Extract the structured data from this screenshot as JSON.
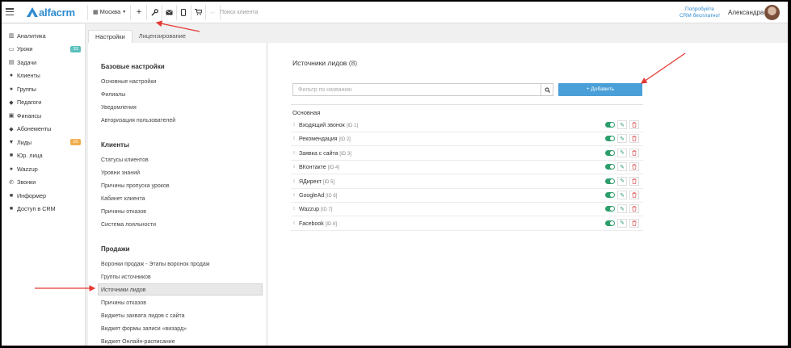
{
  "app": {
    "logo_text": "alfacrm",
    "brand_color": "#2e8bcf",
    "city": "Москва",
    "search_placeholder": "Поиск клиента",
    "try_free": "Попробуйте CRM бесплатно!",
    "user_name": "Александра"
  },
  "toolbar_icons": [
    "building-icon",
    "plus-icon",
    "wrench-icon",
    "mail-icon",
    "phone-icon",
    "cart-icon",
    "minus-icon"
  ],
  "sidebar": {
    "items": [
      {
        "label": "Аналитика",
        "icon": "chart-icon",
        "glyph": "▥"
      },
      {
        "label": "Уроки",
        "icon": "calendar-icon",
        "glyph": "▭",
        "badge": "33",
        "badge_color": "#5bc0be"
      },
      {
        "label": "Задачи",
        "icon": "clipboard-icon",
        "glyph": "▤"
      },
      {
        "label": "Клиенты",
        "icon": "user-icon",
        "glyph": "●"
      },
      {
        "label": "Группы",
        "icon": "users-icon",
        "glyph": "●"
      },
      {
        "label": "Педагоги",
        "icon": "graduation-cap-icon",
        "glyph": "◆"
      },
      {
        "label": "Финансы",
        "icon": "money-icon",
        "glyph": "▣"
      },
      {
        "label": "Абонементы",
        "icon": "tag-icon",
        "glyph": "◆"
      },
      {
        "label": "Лиды",
        "icon": "funnel-icon",
        "glyph": "▼",
        "badge": "22",
        "badge_color": "#f0ad4e"
      },
      {
        "label": "Юр. лица",
        "icon": "briefcase-icon",
        "glyph": "■"
      },
      {
        "label": "Wazzup",
        "icon": "whatsapp-icon",
        "glyph": "●"
      },
      {
        "label": "Звонки",
        "icon": "phone-icon",
        "glyph": "✆"
      },
      {
        "label": "Информер",
        "icon": "bookmark-icon",
        "glyph": "■"
      },
      {
        "label": "Доступ в CRM",
        "icon": "lock-icon",
        "glyph": "■"
      }
    ]
  },
  "tabs": [
    {
      "label": "Настройки",
      "active": true
    },
    {
      "label": "Лицензирование",
      "active": false
    }
  ],
  "settings": {
    "sections": [
      {
        "title": "Базовые настройки",
        "links": [
          "Основные настройки",
          "Филиалы",
          "Уведомления",
          "Авторизация пользователей"
        ]
      },
      {
        "title": "Клиенты",
        "links": [
          "Статусы клиентов",
          "Уровни знаний",
          "Причины пропуска уроков",
          "Кабинет клиента",
          "Причины отказов",
          "Система лояльности"
        ]
      },
      {
        "title": "Продажи",
        "links": [
          "Воронки продаж - Этапы воронок продаж",
          "Группы источников",
          "Источники лидов",
          "Причины отказов",
          "Виджеты захвата лидов с сайта",
          "Виджет формы записи «визард»",
          "Виджет Онлайн-расписание"
        ]
      }
    ],
    "active_link": "Источники лидов"
  },
  "main": {
    "title": "Источники лидов",
    "count": "(8)",
    "filter_placeholder": "Фильтр по названию",
    "add_button": "+ Добавить",
    "group_label": "Основная",
    "toggle_color": "#2e9e6b",
    "rows": [
      {
        "name": "Входящий звонок",
        "id": "[ID 1]"
      },
      {
        "name": "Рекомендация",
        "id": "[ID 2]"
      },
      {
        "name": "Заявка с сайта",
        "id": "[ID 3]"
      },
      {
        "name": "ВКонтакте",
        "id": "[ID 4]"
      },
      {
        "name": "ЯДирект",
        "id": "[ID 5]"
      },
      {
        "name": "GoogleAd",
        "id": "[ID 6]"
      },
      {
        "name": "Wazzup",
        "id": "[ID 7]"
      },
      {
        "name": "Facebook",
        "id": "[ID 8]"
      }
    ]
  },
  "annotation_color": "#e53935"
}
